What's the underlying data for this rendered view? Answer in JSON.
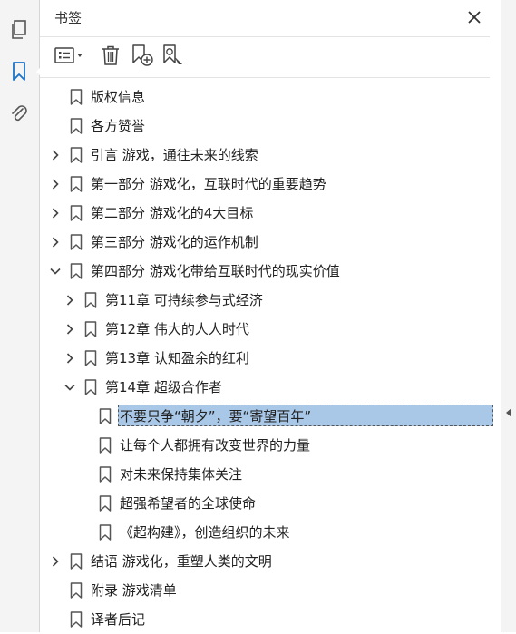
{
  "panel": {
    "title": "书签"
  },
  "rail": {
    "items": [
      {
        "icon": "pages-icon"
      },
      {
        "icon": "bookmark-icon",
        "active": true
      },
      {
        "icon": "attachment-icon"
      }
    ]
  },
  "toolbar": {
    "buttons": [
      {
        "icon": "options-menu-icon"
      },
      {
        "icon": "trash-icon"
      },
      {
        "icon": "new-bookmark-icon"
      },
      {
        "icon": "find-bookmark-icon"
      }
    ]
  },
  "bookmarks": [
    {
      "label": "版权信息",
      "level": 0,
      "twisty": "none"
    },
    {
      "label": "各方赞誉",
      "level": 0,
      "twisty": "none"
    },
    {
      "label": "引言 游戏，通往未来的线索",
      "level": 0,
      "twisty": "collapsed"
    },
    {
      "label": "第一部分 游戏化，互联时代的重要趋势",
      "level": 0,
      "twisty": "collapsed"
    },
    {
      "label": "第二部分 游戏化的4大目标",
      "level": 0,
      "twisty": "collapsed"
    },
    {
      "label": "第三部分 游戏化的运作机制",
      "level": 0,
      "twisty": "collapsed"
    },
    {
      "label": "第四部分 游戏化带给互联时代的现实价值",
      "level": 0,
      "twisty": "expanded"
    },
    {
      "label": "第11章 可持续参与式经济",
      "level": 1,
      "twisty": "collapsed"
    },
    {
      "label": "第12章 伟大的人人时代",
      "level": 1,
      "twisty": "collapsed"
    },
    {
      "label": "第13章 认知盈余的红利",
      "level": 1,
      "twisty": "collapsed"
    },
    {
      "label": "第14章 超级合作者",
      "level": 1,
      "twisty": "expanded"
    },
    {
      "label": "不要只争“朝夕”，要“寄望百年”",
      "level": 2,
      "twisty": "none",
      "selected": true
    },
    {
      "label": "让每个人都拥有改变世界的力量",
      "level": 2,
      "twisty": "none"
    },
    {
      "label": "对未来保持集体关注",
      "level": 2,
      "twisty": "none"
    },
    {
      "label": "超强希望者的全球使命",
      "level": 2,
      "twisty": "none"
    },
    {
      "label": "《超构建》，创造组织的未来",
      "level": 2,
      "twisty": "none"
    },
    {
      "label": "结语 游戏化，重塑人类的文明",
      "level": 0,
      "twisty": "collapsed"
    },
    {
      "label": "附录 游戏清单",
      "level": 0,
      "twisty": "none"
    },
    {
      "label": "译者后记",
      "level": 0,
      "twisty": "none"
    }
  ],
  "colors": {
    "accent": "#1a73c9",
    "selection": "#a9c8e8"
  }
}
